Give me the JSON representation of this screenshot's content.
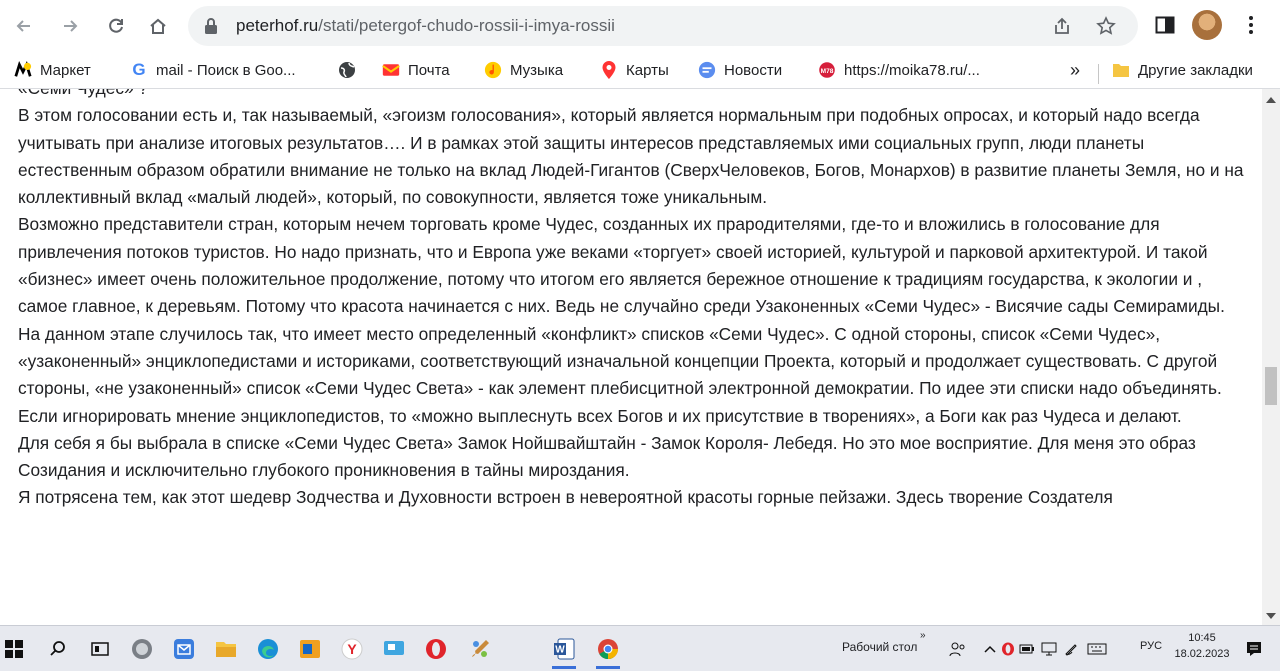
{
  "browser": {
    "url_domain": "peterhof.ru",
    "url_path": "/stati/petergof-chudo-rossii-i-imya-rossii"
  },
  "bookmarks": [
    {
      "label": "Маркет",
      "icon": "yandex-market-icon"
    },
    {
      "label": "mail - Поиск в Goo...",
      "icon": "google-icon"
    },
    {
      "label": "",
      "icon": "globe-icon"
    },
    {
      "label": "Почта",
      "icon": "mail-icon"
    },
    {
      "label": "Музыка",
      "icon": "music-icon"
    },
    {
      "label": "Карты",
      "icon": "maps-icon"
    },
    {
      "label": "Новости",
      "icon": "news-icon"
    },
    {
      "label": "https://moika78.ru/...",
      "icon": "moika78-icon"
    }
  ],
  "bookmarks_more": "»",
  "other_bookmarks": "Другие закладки",
  "article": {
    "cut_line": "«Семи Чудес» ?",
    "paragraphs": [
      "В этом голосовании есть и, так называемый, «эгоизм голосования», который является нормальным при подобных опросах, и который надо всегда учитывать при анализе итоговых результатов…. И в рамках этой защиты интересов представляемых ими социальных групп, люди планеты естественным образом обратили внимание не только на вклад Людей-Гигантов (СверхЧеловеков, Богов, Монархов) в развитие планеты Земля, но и на коллективный вклад «малый людей», который, по совокупности, является тоже уникальным.",
      "Возможно представители стран, которым нечем торговать кроме Чудес, созданных их прародителями, где-то и вложились в голосование для привлечения потоков туристов. Но надо признать, что и Европа уже веками «торгует» своей историей, культурой и парковой архитектурой. И такой «бизнес» имеет очень положительное продолжение, потому что итогом его является бережное отношение к традициям государства, к экологии и , самое главное, к деревьям. Потому что красота начинается с них. Ведь не случайно среди Узаконенных «Семи Чудес» - Висячие сады Семирамиды.",
      "На данном этапе случилось так, что имеет место определенный «конфликт» списков «Семи Чудес». С одной стороны, список «Семи Чудес», «узаконенный» энциклопедистами и историками, соответствующий изначальной концепции Проекта, который и продолжает существовать. С другой стороны, «не узаконенный» список «Семи Чудес Света» - как элемент плебисцитной электронной демократии. По идее эти списки надо объединять. Если игнорировать мнение энциклопедистов, то «можно выплеснуть всех Богов и их присутствие в творениях», а Боги как раз Чудеса и делают.",
      "Для себя я бы выбрала в списке «Семи Чудес Света» Замок Нойшвайштайн - Замок Короля- Лебедя. Но это мое восприятие. Для меня это образ Созидания и исключительно глубокого проникновения в тайны мироздания.",
      "Я потрясена тем, как этот шедевр Зодчества и Духовности встроен в невероятной красоты горные пейзажи. Здесь творение Создателя"
    ]
  },
  "taskbar": {
    "desktop_label": "Рабочий стол",
    "language": "РУС",
    "time": "10:45",
    "date": "18.02.2023"
  },
  "colors": {
    "accent": "#3a6fd8",
    "omnibox_bg": "#f1f3f4",
    "taskbar_bg": "#e7e9ef",
    "opera_red": "#e0242b",
    "yandex_yellow": "#ffcc00"
  }
}
